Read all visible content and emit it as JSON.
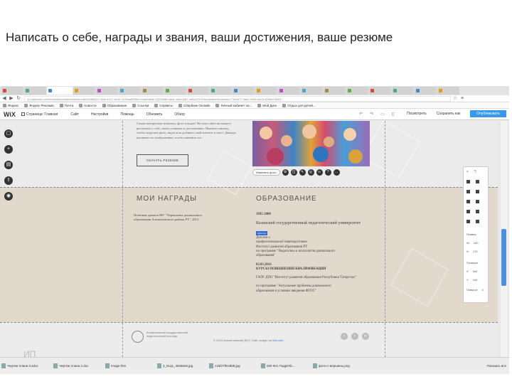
{
  "slide_title": "Написать о себе, награды и звания, ваши достижения, ваше резюме",
  "browser": {
    "tabs": [
      "",
      "",
      "",
      "",
      "",
      "",
      "",
      "",
      "",
      "",
      "",
      "",
      "",
      "",
      "",
      "",
      "",
      "",
      "",
      ""
    ],
    "url": "12.editorwix.com/html/editor/web/renderer/edit/c9388415-7a9d-4417-bc2b-3133da899ffd?metaSiteId=2322f6d9-eab4-4ac6-b6f7-4e8c27d7e0ec&editorSessionId=71e5577-0a63-435e-9a7d-8308ef7d000",
    "bookmarks": [
      "Яндекс",
      "Яндекс Реклама",
      "Почта",
      "Новости",
      "Образование",
      "Ссылки",
      "Cервисы",
      "Сбербанк Онлайн",
      "Личный кабинет на...",
      "Мой Диск",
      "Отдых для детей..."
    ]
  },
  "wix": {
    "logo": "WiX",
    "page_selector": "Страница: Главная",
    "menu": [
      "Сайт",
      "Настройки",
      "Помощь",
      "Обновить",
      "Обзор"
    ],
    "preview": "Посмотреть",
    "save": "Сохранить как",
    "publish": "Опубликовать"
  },
  "canvas": {
    "top_text": "Самые интересные моменты, фото и видео! На этом сайте вы можете рассказать о себе, своих учениках и достижениях. Нажмите кнопку, чтобы загрузить фото, видео или добавить свой контент и текст. Дважды щелкните по изображению, чтобы заменить его.",
    "resume_button": "СКАЧАТЬ РЕЗЮМЕ",
    "photo_toolbar_label": "Изменить фото",
    "awards_heading": "МОИ НАГРАДЫ",
    "awards_text": "Почетная грамота МУ \"Управление дошкольного образования Альметьевского района РТ\", 2012",
    "education_heading": "ОБРАЗОВАНИЕ",
    "education": {
      "years1": "1995-2000",
      "university": "Казанский государственный педагогический университет",
      "badge": "Диплом",
      "diploma_lines": [
        "Диплом о",
        "профессиональной переподготовке",
        "Институт развития образования РТ",
        "по программе \"Педагогика и психология дошкольного",
        "образования\""
      ],
      "date2": "03.03.2016",
      "course_title": "КУРСЫ ПОВЫШЕНИЯ КВАЛИФИКАЦИИ",
      "org": "ГАОУ ДПО \"Институт развития образования Республики Татарстан\"",
      "program_lines": [
        "по программе \"Актуальные проблемы дошкольного",
        "образования в условиях введения ФГОС\""
      ]
    },
    "footer": {
      "org_name": "Альметьевский государственный педагогический колледж",
      "copyright": "© 2023 Альметьевский ДОУ. Сайт создан на",
      "copyright_link": "Wix.com",
      "mark": "ИП"
    }
  },
  "side_panel": {
    "labels": [
      "Размер",
      "W",
      "H",
      "Позиция",
      "X",
      "Y",
      "Поворот"
    ],
    "values": [
      "440",
      "170",
      "540",
      "240",
      "0"
    ]
  },
  "downloads": [
    "Чертеж плана 3.sdoc",
    "Чертеж плана 2.doc",
    "Image.htm",
    "3_51q1_4625626.jpg",
    "z15f27f91i858.jpg",
    "000 001 ПодрОбс...",
    "фото-с-вершины.png"
  ],
  "downloads_all": "Показать все"
}
